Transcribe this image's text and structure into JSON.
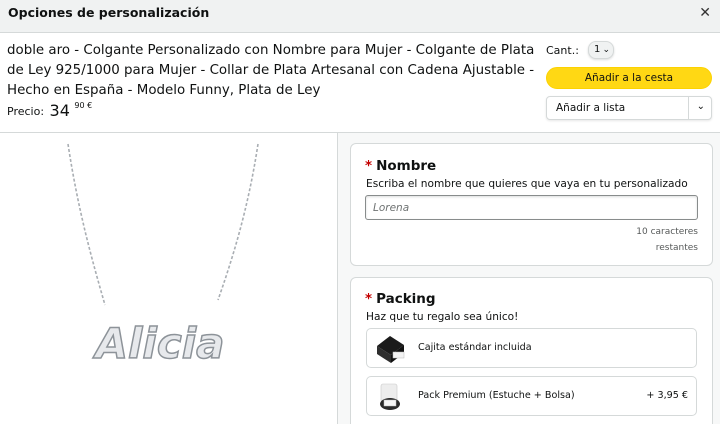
{
  "modal": {
    "title": "Opciones de personalización",
    "close_icon": "close-icon"
  },
  "product": {
    "title": "doble aro - Colgante Personalizado con Nombre para Mujer - Colgante de Plata de Ley 925/1000 para Mujer - Collar de Plata Artesanal con Cadena Ajustable - Hecho en España - Modelo Funny, Plata de Ley",
    "price_label": "Precio:",
    "price_whole": "34",
    "price_fraction": "90 €",
    "image_text": "Alicia"
  },
  "purchase": {
    "qty_label": "Cant.:",
    "qty_value": "1",
    "add_to_cart": "Añadir a la cesta",
    "add_to_list": "Añadir a lista"
  },
  "name_field": {
    "required_mark": "*",
    "title": "Nombre",
    "description": "Escriba el nombre que quieres que vaya en tu personalizado",
    "placeholder": "Lorena",
    "value": "",
    "chars_left_line1": "10 caracteres",
    "chars_left_line2": "restantes"
  },
  "packing": {
    "required_mark": "*",
    "title": "Packing",
    "description": "Haz que tu regalo sea único!",
    "options": [
      {
        "label": "Cajita estándar incluida",
        "price": "",
        "icon": "gift-box-thumbnail"
      },
      {
        "label": "Pack Premium (Estuche + Bolsa)",
        "price": "+ 3,95 €",
        "icon": "premium-pack-thumbnail"
      }
    ]
  },
  "colors": {
    "cart_button": "#ffd814",
    "required": "#c40000",
    "header_bg": "#f0f2f2",
    "pane_bg": "#f7f8f8"
  }
}
